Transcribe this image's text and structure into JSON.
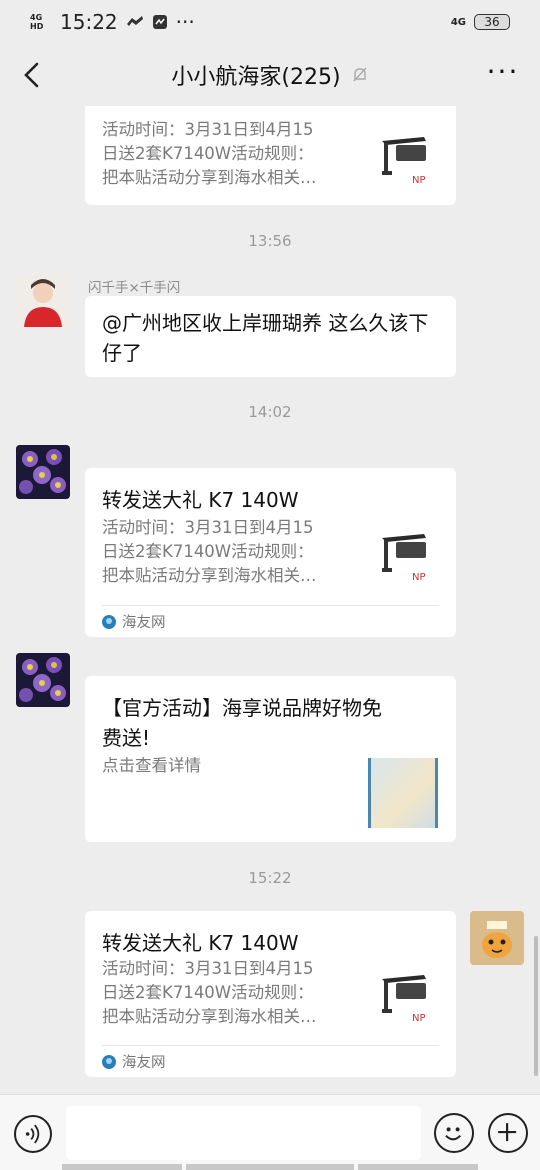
{
  "status": {
    "time": "15:22",
    "network_left": "4G HD",
    "network_right": "4G",
    "battery": "36",
    "more": "···"
  },
  "header": {
    "title": "小小航海家(225)",
    "more": "···"
  },
  "messages": {
    "card_top": {
      "desc_line1": "活动时间：3月31日到4月15",
      "desc_line2": "日送2套K7140W活动规则：",
      "desc_line3": "把本贴活动分享到海水相关…"
    },
    "time1": "13:56",
    "msg1": {
      "sender": "闪千手×千手闪",
      "text": "@广州地区收上岸珊瑚养  这么久该下仔了"
    },
    "time2": "14:02",
    "card2": {
      "title": "转发送大礼 K7 140W",
      "desc_line1": "活动时间：3月31日到4月15",
      "desc_line2": "日送2套K7140W活动规则：",
      "desc_line3": "把本贴活动分享到海水相关…",
      "source": "海友网"
    },
    "card3": {
      "title_line1": "【官方活动】海享说品牌好物免",
      "title_line2": "费送!",
      "desc": "点击查看详情"
    },
    "time3": "15:22",
    "card4": {
      "title": "转发送大礼 K7 140W",
      "desc_line1": "活动时间：3月31日到4月15",
      "desc_line2": "日送2套K7140W活动规则：",
      "desc_line3": "把本贴活动分享到海水相关…",
      "source": "海友网"
    }
  },
  "colors": {
    "background": "#ededed",
    "bubble": "#ffffff",
    "muted": "#7a7a7a"
  }
}
